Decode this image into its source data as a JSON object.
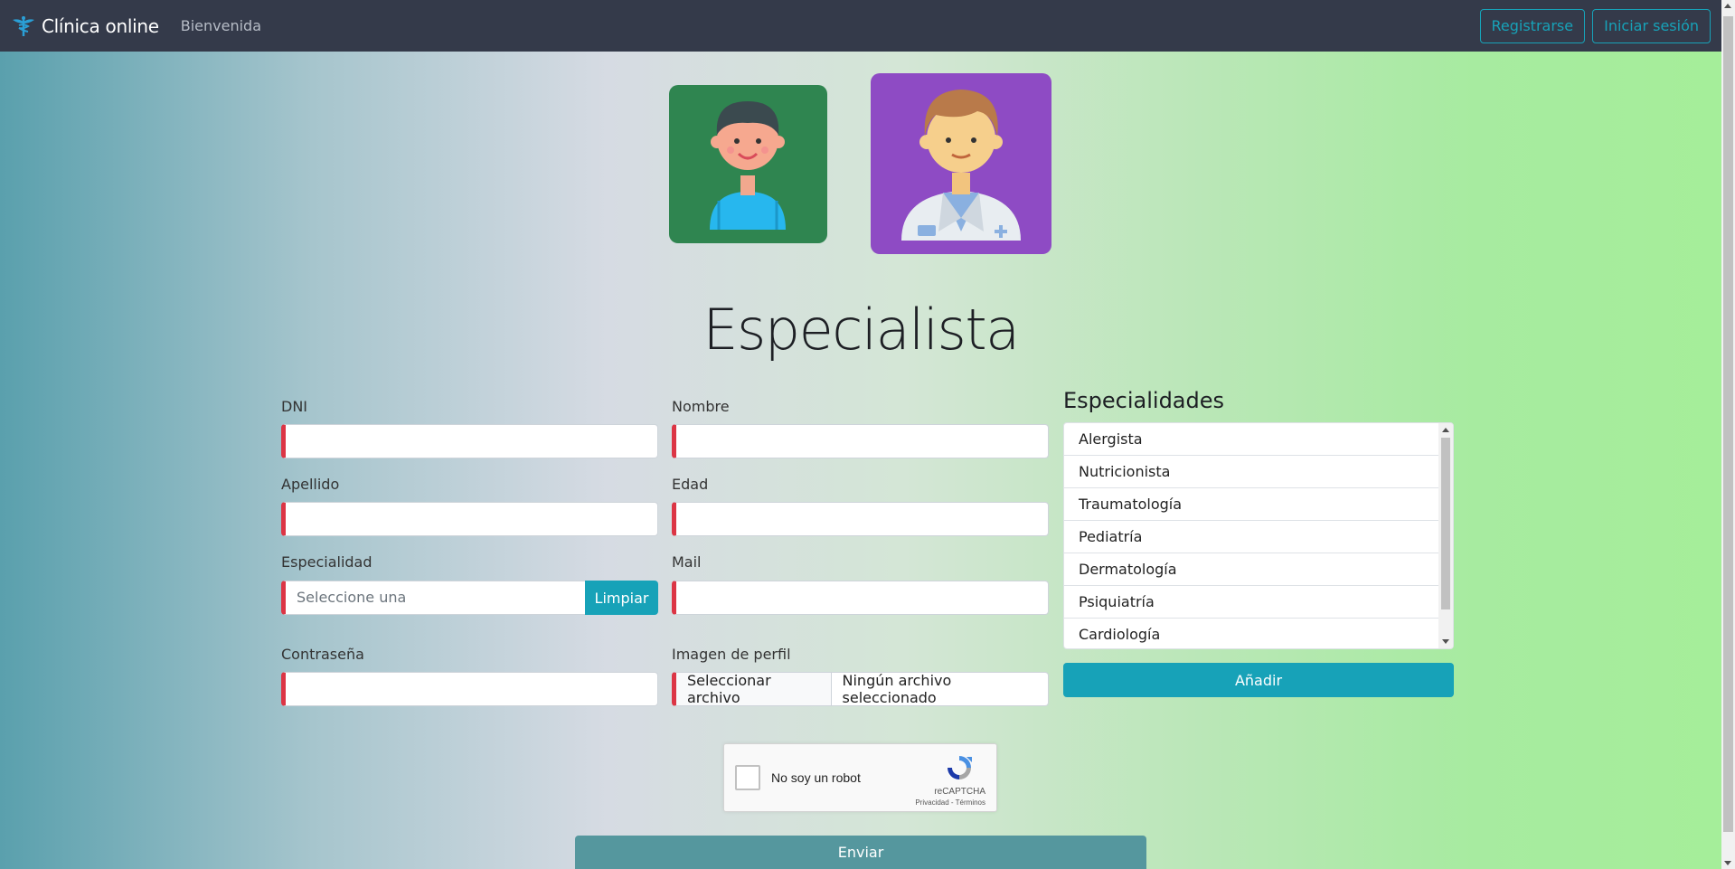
{
  "navbar": {
    "brand": "Clínica online",
    "link_bienvenida": "Bienvenida",
    "btn_register": "Registrarse",
    "btn_login": "Iniciar sesión",
    "accent": "#17a2b8"
  },
  "header": {
    "title": "Especialista",
    "avatars": [
      "patient-avatar",
      "doctor-avatar"
    ]
  },
  "form": {
    "dni_label": "DNI",
    "nombre_label": "Nombre",
    "apellido_label": "Apellido",
    "edad_label": "Edad",
    "especialidad_label": "Especialidad",
    "especialidad_placeholder": "Seleccione una",
    "btn_clear": "Limpiar",
    "mail_label": "Mail",
    "password_label": "Contraseña",
    "imagen_label": "Imagen de perfil",
    "file_button": "Seleccionar archivo",
    "file_status": "Ningún archivo seleccionado",
    "invalid_color": "#dc3545"
  },
  "especialidades": {
    "title": "Especialidades",
    "items": [
      "Alergista",
      "Nutricionista",
      "Traumatología",
      "Pediatría",
      "Dermatología",
      "Psiquiatría",
      "Cardiología"
    ],
    "btn_add": "Añadir"
  },
  "captcha": {
    "label": "No soy un robot",
    "brand": "reCAPTCHA",
    "links": "Privacidad - Términos"
  },
  "submit": {
    "label": "Enviar"
  }
}
